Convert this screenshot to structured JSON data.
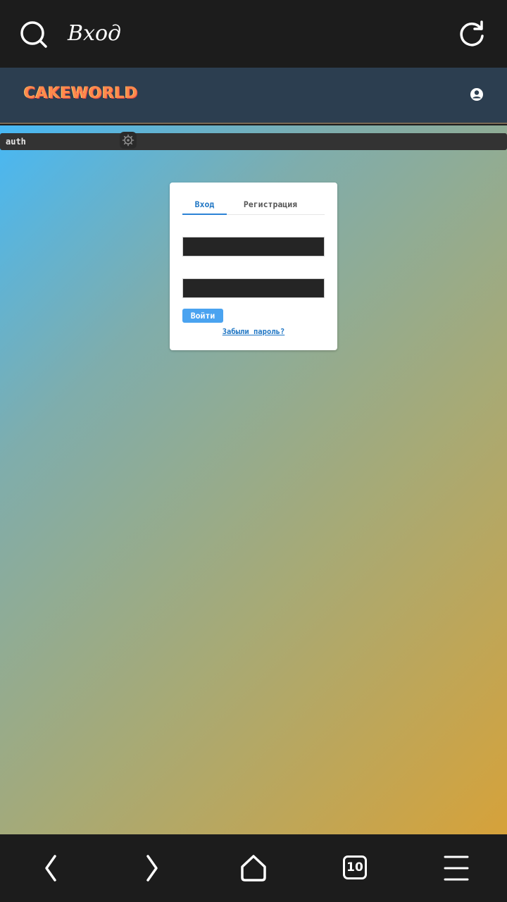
{
  "browser": {
    "page_title": "Вход",
    "tabs_count": "10"
  },
  "site": {
    "logo_text": "CAKEWORLD"
  },
  "debug_bar": {
    "label": "auth"
  },
  "login_card": {
    "tabs": [
      {
        "label": "Вход",
        "active": true
      },
      {
        "label": "Регистрация",
        "active": false
      }
    ],
    "login_field_value": "",
    "password_field_value": "",
    "submit_label": "Войти",
    "forgot_label": "Забыли пароль?"
  },
  "colors": {
    "accent": "#2c83d6",
    "header_bg": "#2c3e50",
    "button_bg": "#4aa3f0",
    "logo": "#ff8a4c",
    "gradient_start": "#47b8f5",
    "gradient_end": "#d6a23a"
  },
  "icons": {
    "search": "search-icon",
    "reload": "reload-icon",
    "user": "user-circle-icon",
    "gear": "gear-icon",
    "back": "chevron-left-icon",
    "forward": "chevron-right-icon",
    "home": "home-icon",
    "tabs": "tabs-icon",
    "menu": "menu-icon"
  }
}
